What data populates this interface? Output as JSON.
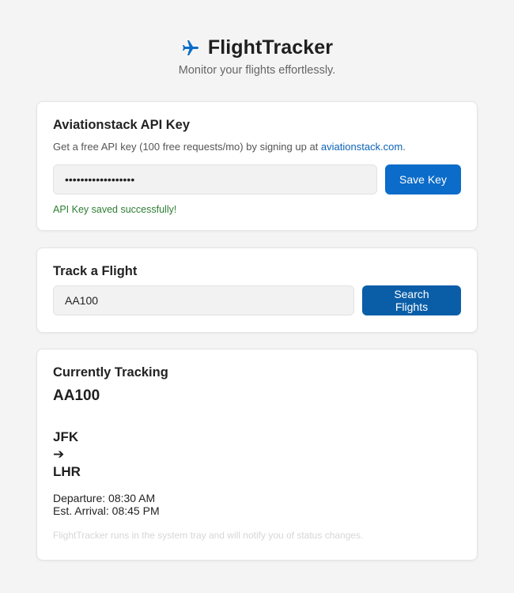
{
  "app": {
    "title": "FlightTracker",
    "tagline": "Monitor your flights effortlessly."
  },
  "api_card": {
    "heading": "Aviationstack API Key",
    "help_prefix": "Get a free API key (100 free requests/mo) by signing up at ",
    "help_link": "aviationstack.com",
    "help_suffix": ".",
    "key_value": "••••••••••••••••••",
    "save_label": "Save Key",
    "status": "API Key saved successfully!"
  },
  "track_card": {
    "heading": "Track a Flight",
    "flight_value": "AA100",
    "search_label": "Search Flights"
  },
  "tracking_card": {
    "heading": "Currently Tracking",
    "flight_number": "AA100",
    "origin": "JFK",
    "arrow": "➔",
    "destination": "LHR",
    "departure": "Departure: 08:30 AM",
    "arrival": "Est. Arrival: 08:45 PM",
    "footnote": "FlightTracker runs in the system tray and will notify you of status changes."
  },
  "colors": {
    "accent": "#0b6cc9",
    "accent_dark": "#0a5ea8",
    "success": "#2e7d32",
    "link": "#0b63b6"
  },
  "icons": {
    "brand": "airplane-icon"
  }
}
